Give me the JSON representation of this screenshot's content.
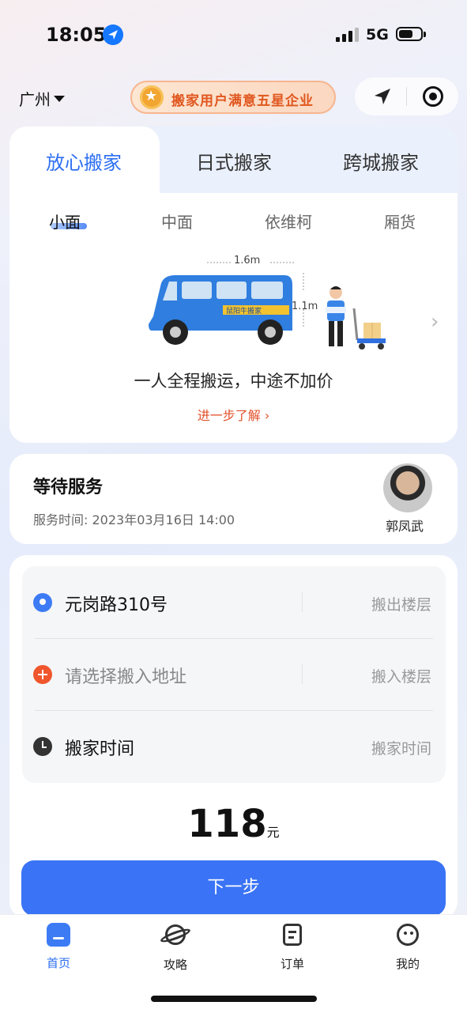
{
  "status_bar": {
    "time": "18:05",
    "network": "5G"
  },
  "header": {
    "city": "广州",
    "badge_text": "搬家用户满意五星企业"
  },
  "service_tabs": [
    {
      "label": "放心搬家",
      "active": true
    },
    {
      "label": "日式搬家",
      "active": false
    },
    {
      "label": "跨城搬家",
      "active": false
    }
  ],
  "vehicles": [
    {
      "label": "小面",
      "active": true
    },
    {
      "label": "中面",
      "active": false
    },
    {
      "label": "依维柯",
      "active": false
    },
    {
      "label": "厢货",
      "active": false
    }
  ],
  "vehicle_info": {
    "length": "1.6m",
    "height": "1.1m",
    "van_label": "鼠阳牛搬家",
    "slogan": "一人全程搬运，中途不加价",
    "learn_more": "进一步了解 ›"
  },
  "order_status": {
    "title": "等待服务",
    "service_time": "服务时间: 2023年03月16日 14:00",
    "driver_name": "郭凤武"
  },
  "form": {
    "from_address": "元岗路310号",
    "from_floor": "搬出楼层",
    "to_address_placeholder": "请选择搬入地址",
    "to_floor": "搬入楼层",
    "time_label": "搬家时间",
    "time_value": "搬家时间"
  },
  "price": {
    "amount": "118",
    "unit": "元"
  },
  "next_button": "下一步",
  "bottom_nav": [
    {
      "label": "首页",
      "icon": "home-icon",
      "active": true
    },
    {
      "label": "攻略",
      "icon": "planet-icon",
      "active": false
    },
    {
      "label": "订单",
      "icon": "order-icon",
      "active": false
    },
    {
      "label": "我的",
      "icon": "smile-icon",
      "active": false
    }
  ],
  "colors": {
    "accent": "#3a73f5",
    "warning": "#e2502a",
    "badge": "#e0571f"
  }
}
